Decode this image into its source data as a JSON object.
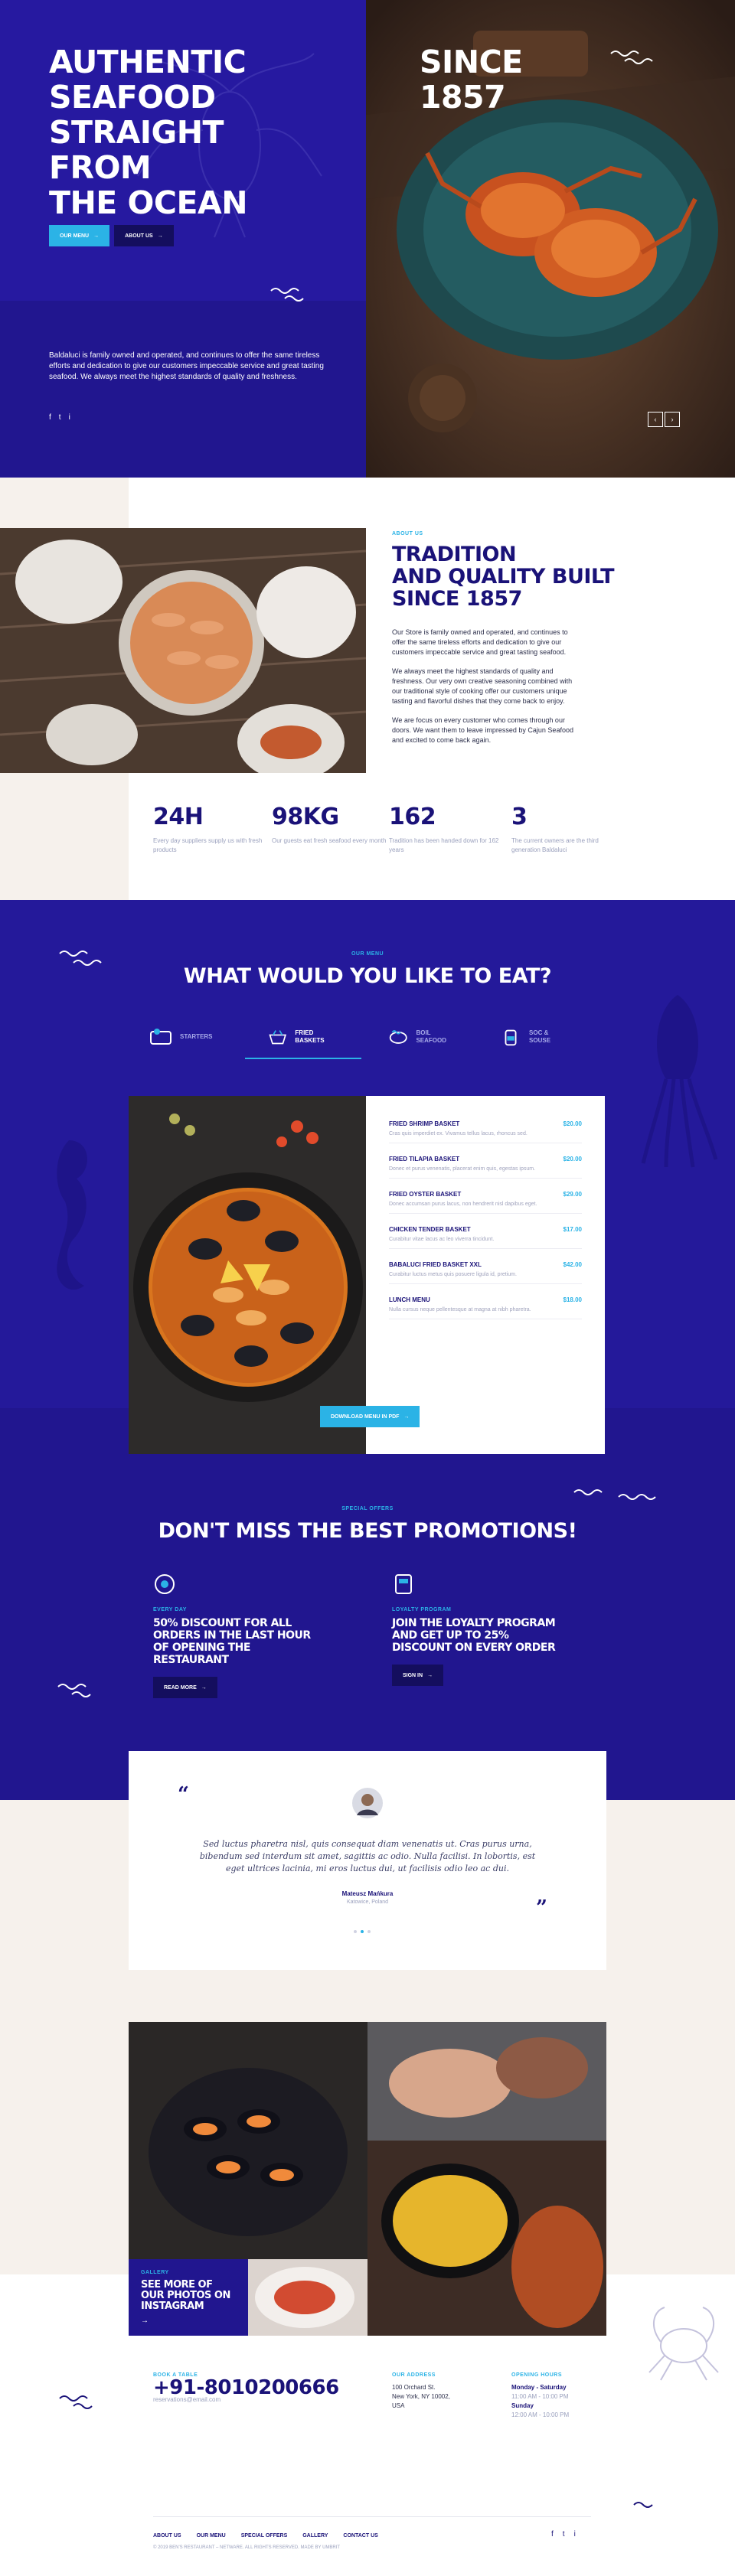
{
  "hero": {
    "title_lines": [
      "AUTHENTIC",
      "SEAFOOD",
      "STRAIGHT FROM",
      "THE OCEAN"
    ],
    "since_lines": [
      "SINCE",
      "1857"
    ],
    "btn_menu": "OUR MENU",
    "btn_about": "ABOUT US",
    "description": "Baldaluci is family owned and operated, and continues to offer the same tireless efforts and dedication to give our customers impeccable service and great tasting seafood. We always meet the highest standards of quality and freshness.",
    "social": [
      "f",
      "t",
      "i"
    ]
  },
  "about": {
    "eyebrow": "ABOUT US",
    "heading_lines": [
      "TRADITION",
      "AND QUALITY BUILT",
      "SINCE 1857"
    ],
    "paragraphs": [
      "Our Store is family owned and operated, and continues to offer the same tireless efforts and dedication to give our customers impeccable service and great tasting seafood.",
      "We always meet the highest standards of quality and freshness. Our very own creative seasoning combined with our traditional style of cooking offer our customers unique tasting and flavorful dishes that they come back to enjoy.",
      "We are focus on every customer who comes through our doors. We want them to leave impressed by Cajun Seafood and excited to come back again."
    ],
    "stats": [
      {
        "num": "24H",
        "desc": "Every day suppliers supply us with fresh products"
      },
      {
        "num": "98KG",
        "desc": "Our guests eat fresh seafood every month"
      },
      {
        "num": "162",
        "desc": "Tradition has been handed down for 162 years"
      },
      {
        "num": "3",
        "desc": "The current owners are the third generation Baldaluci"
      }
    ]
  },
  "menu": {
    "eyebrow": "OUR MENU",
    "title": "WHAT WOULD YOU LIKE TO EAT?",
    "tabs": [
      {
        "label": "STARTERS",
        "active": false
      },
      {
        "label": "FRIED BASKETS",
        "active": true
      },
      {
        "label": "BOIL SEAFOOD",
        "active": false
      },
      {
        "label": "SOC & SOUSE",
        "active": false
      }
    ],
    "items": [
      {
        "name": "FRIED SHRIMP BASKET",
        "price": "$20.00",
        "desc": "Cras quis imperdiet ex. Vivamus tellus lacus, rhoncus sed."
      },
      {
        "name": "FRIED TILAPIA BASKET",
        "price": "$20.00",
        "desc": "Donec et purus venenatis, placerat enim quis, egestas ipsum."
      },
      {
        "name": "FRIED OYSTER BASKET",
        "price": "$29.00",
        "desc": "Donec accumsan purus lacus, non hendrerit nisl dapibus eget."
      },
      {
        "name": "CHICKEN TENDER BASKET",
        "price": "$17.00",
        "desc": "Curabitur vitae lacus ac leo viverra tincidunt."
      },
      {
        "name": "BABALUCI FRIED BASKET XXL",
        "price": "$42.00",
        "desc": "Curabitur luctus metus quis posuere ligula id, pretium."
      },
      {
        "name": "LUNCH MENU",
        "price": "$18.00",
        "desc": "Nulla cursus neque pellentesque at magna at nibh pharetra."
      }
    ],
    "download": "DOWNLOAD MENU IN PDF"
  },
  "promos": {
    "eyebrow": "SPECIAL OFFERS",
    "title": "DON'T MISS THE BEST PROMOTIONS!",
    "items": [
      {
        "eyebrow": "EVERY DAY",
        "head": "50% DISCOUNT FOR ALL ORDERS IN THE LAST HOUR OF OPENING THE RESTAURANT",
        "btn": "READ MORE"
      },
      {
        "eyebrow": "LOYALTY PROGRAM",
        "head": "JOIN THE LOYALTY PROGRAM AND GET UP TO 25% DISCOUNT ON EVERY ORDER",
        "btn": "SIGN IN"
      }
    ]
  },
  "testimonial": {
    "quote": "Sed luctus pharetra nisl, quis consequat diam venenatis ut. Cras purus urna, bibendum sed interdum sit amet, sagittis ac odio. Nulla facilisi. In lobortis, est eget ultrices lacinia, mi eros luctus dui, ut facilisis odio leo ac dui.",
    "name": "Mateusz Mańkura",
    "place": "Katowice, Poland"
  },
  "gallery": {
    "eyebrow": "GALLERY",
    "heading": "SEE MORE OF OUR PHOTOS ON INSTAGRAM",
    "arrow": "→"
  },
  "footer": {
    "book_label": "BOOK A TABLE",
    "phone": "+91-8010200666",
    "email": "reservations@email.com",
    "address_label": "OUR ADDRESS",
    "address": [
      "100 Orchard St.",
      "New York, NY 10002,",
      "USA"
    ],
    "hours_label": "OPENING HOURS",
    "hours": [
      "Monday - Saturday",
      "11:00 AM - 10:00 PM",
      "Sunday",
      "12:00 AM - 10:00 PM"
    ],
    "links": [
      "ABOUT US",
      "OUR MENU",
      "SPECIAL OFFERS",
      "GALLERY",
      "CONTACT US"
    ],
    "copyright": "© 2019 BEN'S RESTAURANT – NETWARE. ALL RIGHTS RESERVED. MADE BY UMBRIT",
    "social": [
      "f",
      "t",
      "i"
    ]
  },
  "colors": {
    "navy": "#24199a",
    "cyan": "#2bb3e6",
    "beige": "#f6f1ec"
  }
}
